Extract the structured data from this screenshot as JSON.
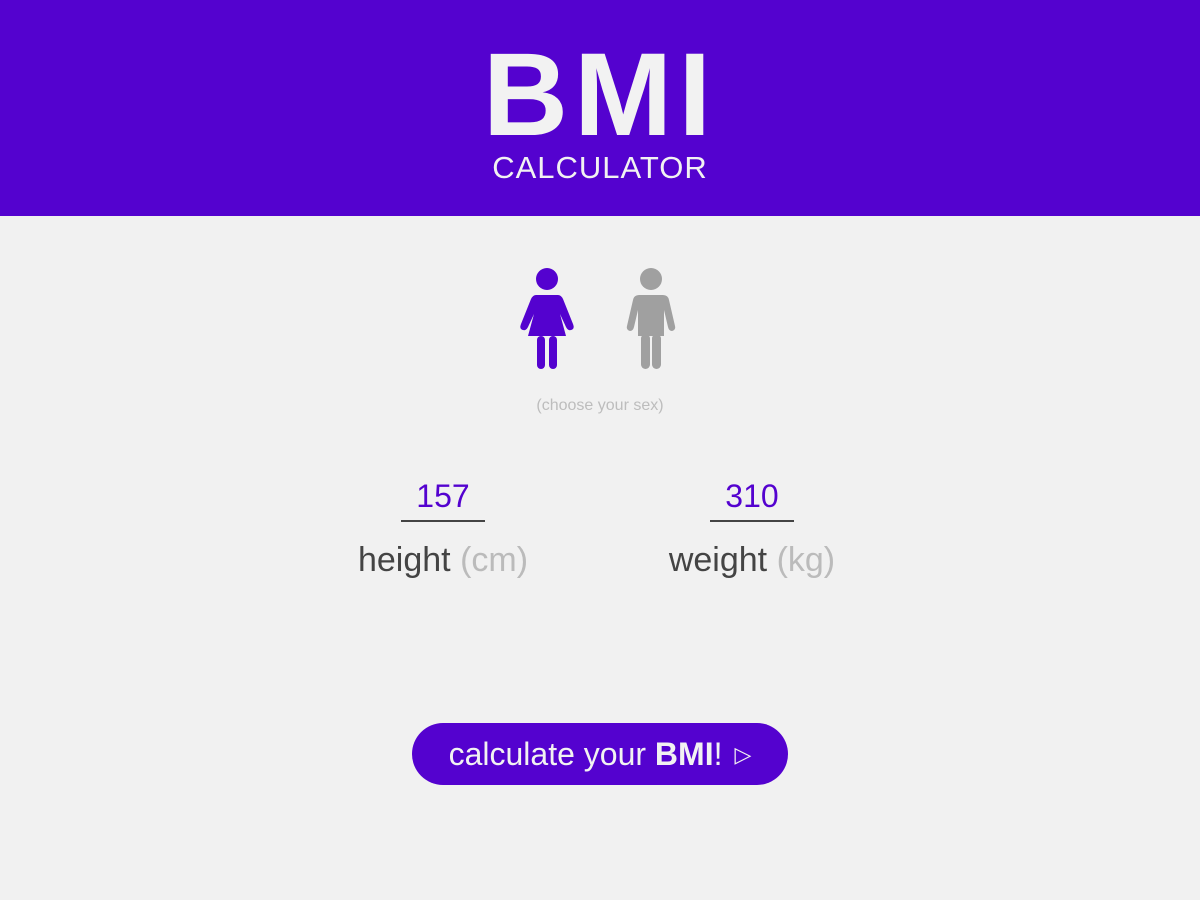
{
  "header": {
    "logo_main": "BMI",
    "logo_sub": "CALCULATOR"
  },
  "sex": {
    "options": [
      {
        "name": "female",
        "selected": true,
        "color": "#5402cf",
        "icon": "female-icon"
      },
      {
        "name": "male",
        "selected": false,
        "color": "#a0a0a0",
        "icon": "male-icon"
      }
    ],
    "hint": "(choose your sex)"
  },
  "height": {
    "value": "157",
    "label": "height",
    "unit": "(cm)"
  },
  "weight": {
    "value": "310",
    "label": "weight",
    "unit": "(kg)"
  },
  "button": {
    "prefix": "calculate your",
    "strong": "BMI",
    "suffix": "!",
    "arrow": "▷"
  },
  "colors": {
    "accent": "#5402cf",
    "background": "#f1f1f1",
    "muted": "#bbbbbb",
    "text": "#444444"
  }
}
